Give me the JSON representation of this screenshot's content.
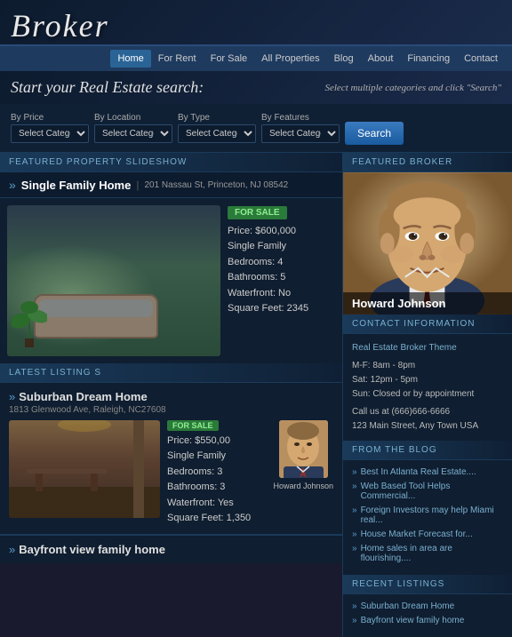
{
  "header": {
    "logo": "Broker",
    "tagline_left": "Start your Real Estate search:",
    "tagline_right": "Select multiple categories and click  \"Search\""
  },
  "nav": {
    "items": [
      {
        "label": "Home",
        "active": true
      },
      {
        "label": "For Rent",
        "active": false
      },
      {
        "label": "For Sale",
        "active": false
      },
      {
        "label": "All Properties",
        "active": false
      },
      {
        "label": "Blog",
        "active": false
      },
      {
        "label": "About",
        "active": false
      },
      {
        "label": "Financing",
        "active": false
      },
      {
        "label": "Contact",
        "active": false
      }
    ]
  },
  "search": {
    "by_price_label": "By Price",
    "by_location_label": "By Location",
    "by_type_label": "By Type",
    "by_features_label": "By Features",
    "placeholder": "Select Category",
    "button_label": "Search"
  },
  "featured_property": {
    "section_label": "FEATURED PROPERTY SLIDESHOW",
    "chevron": "»",
    "title": "Single Family Home",
    "separator": "|",
    "address": "201 Nassau St, Princeton, NJ 08542",
    "badge": "FOR SALE",
    "price": "Price: $600,000",
    "type": "Single Family",
    "bedrooms": "Bedrooms: 4",
    "bathrooms": "Bathrooms: 5",
    "waterfront": "Waterfront: No",
    "sqft": "Square Feet: 2345"
  },
  "latest_listings": {
    "section_label": "LATEST LISTING S",
    "items": [
      {
        "chevron": "»",
        "title": "Suburban Dream Home",
        "address": "1813 Glenwood Ave, Raleigh, NC27608",
        "badge": "FOR SALE",
        "price": "Price: $550,00",
        "type": "Single Family",
        "bedrooms": "Bedrooms: 3",
        "bathrooms": "Bathrooms: 3",
        "waterfront": "Waterfront: Yes",
        "sqft": "Square Feet: 1,350",
        "broker_name": "Howard Johnson"
      }
    ]
  },
  "bayfront": {
    "chevron": "»",
    "title": "Bayfront view family home"
  },
  "featured_broker": {
    "section_label": "FEATURED BROKER",
    "broker_name": "Howard Johnson"
  },
  "contact": {
    "section_label": "CONTACT INFORMATION",
    "company": "Real Estate Broker Theme",
    "hours1": "M-F: 8am - 8pm",
    "hours2": "Sat: 12pm - 5pm",
    "hours3": "Sun: Closed or by appointment",
    "phone_label": "Call us at (666)666-6666",
    "address": "123 Main Street, Any Town USA"
  },
  "blog": {
    "section_label": "FROM THE BLOG",
    "items": [
      "Best In Atlanta Real Estate....",
      "Web Based Tool Helps Commercial...",
      "Foreign Investors may help Miami real...",
      "House Market Forecast for...",
      "Home sales in area are flourishing...."
    ]
  },
  "recent_listings": {
    "section_label": "RECENT LISTINGS",
    "items": [
      "Suburban Dream Home",
      "Bayfront view family home"
    ]
  }
}
